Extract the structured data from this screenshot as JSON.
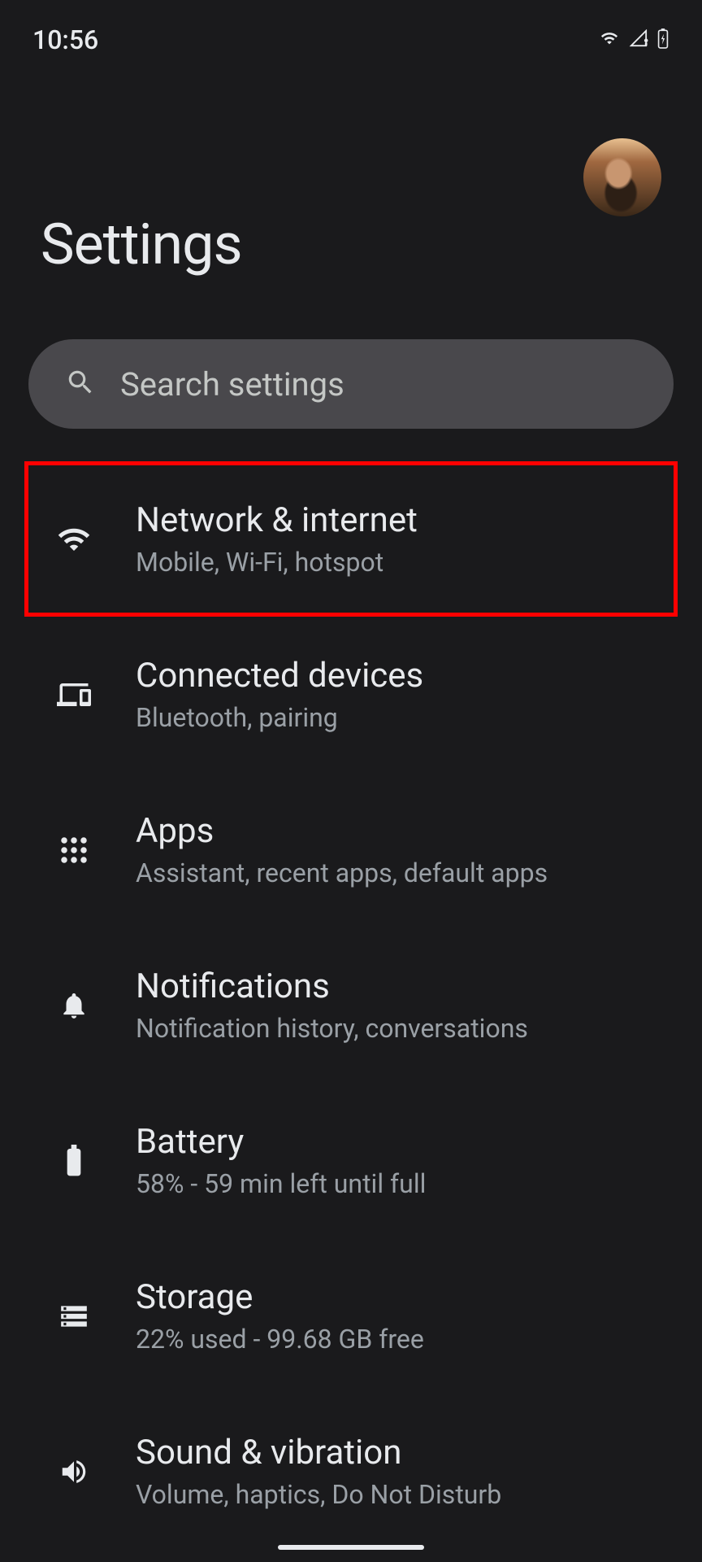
{
  "status_bar": {
    "time": "10:56"
  },
  "header": {
    "title": "Settings"
  },
  "search": {
    "placeholder": "Search settings"
  },
  "settings": [
    {
      "icon": "wifi",
      "title": "Network & internet",
      "subtitle": "Mobile, Wi-Fi, hotspot",
      "highlighted": true
    },
    {
      "icon": "devices",
      "title": "Connected devices",
      "subtitle": "Bluetooth, pairing"
    },
    {
      "icon": "apps",
      "title": "Apps",
      "subtitle": "Assistant, recent apps, default apps"
    },
    {
      "icon": "notifications",
      "title": "Notifications",
      "subtitle": "Notification history, conversations"
    },
    {
      "icon": "battery",
      "title": "Battery",
      "subtitle": "58% - 59 min left until full"
    },
    {
      "icon": "storage",
      "title": "Storage",
      "subtitle": "22% used - 99.68 GB free"
    },
    {
      "icon": "sound",
      "title": "Sound & vibration",
      "subtitle": "Volume, haptics, Do Not Disturb"
    }
  ]
}
